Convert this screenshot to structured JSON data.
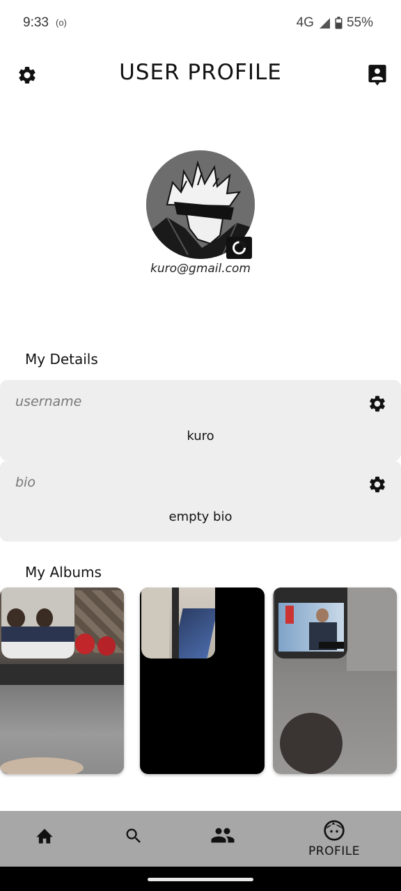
{
  "status_bar": {
    "time": "9:33",
    "radio": "(o)",
    "network": "4G",
    "battery": "55%"
  },
  "header": {
    "title": "USER PROFILE",
    "left_icon": "gear-icon",
    "right_icon": "contact-card-icon"
  },
  "profile": {
    "email": "kuro@gmail.com",
    "avatar_icon": "anime-avatar",
    "camera_icon": "camera-icon"
  },
  "details": {
    "title": "My Details",
    "fields": [
      {
        "label": "username",
        "value": "kuro"
      },
      {
        "label": "bio",
        "value": "empty bio"
      }
    ]
  },
  "albums": {
    "title": "My Albums",
    "items": [
      "classroom-photo",
      "dark-photo",
      "tv-screen-photo"
    ]
  },
  "bottom_nav": {
    "items": [
      {
        "icon": "home-icon",
        "label": ""
      },
      {
        "icon": "search-icon",
        "label": ""
      },
      {
        "icon": "people-icon",
        "label": ""
      },
      {
        "icon": "face-icon",
        "label": "PROFILE"
      }
    ]
  },
  "colors": {
    "card_bg": "#eeeeee",
    "nav_bg": "#a7a7a7",
    "avatar_bg": "#6d6d6d"
  }
}
